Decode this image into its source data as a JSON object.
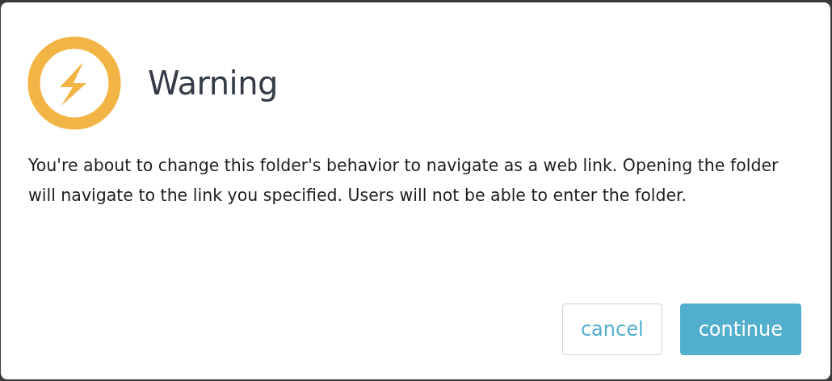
{
  "dialog": {
    "title": "Warning",
    "message": "You're about to change this folder's behavior to navigate as a web link. Opening the folder will navigate to the link you specified. Users will not be able to enter the folder.",
    "buttons": [
      {
        "label": "cancel",
        "kind": "secondary"
      },
      {
        "label": "continue",
        "kind": "primary"
      }
    ]
  }
}
